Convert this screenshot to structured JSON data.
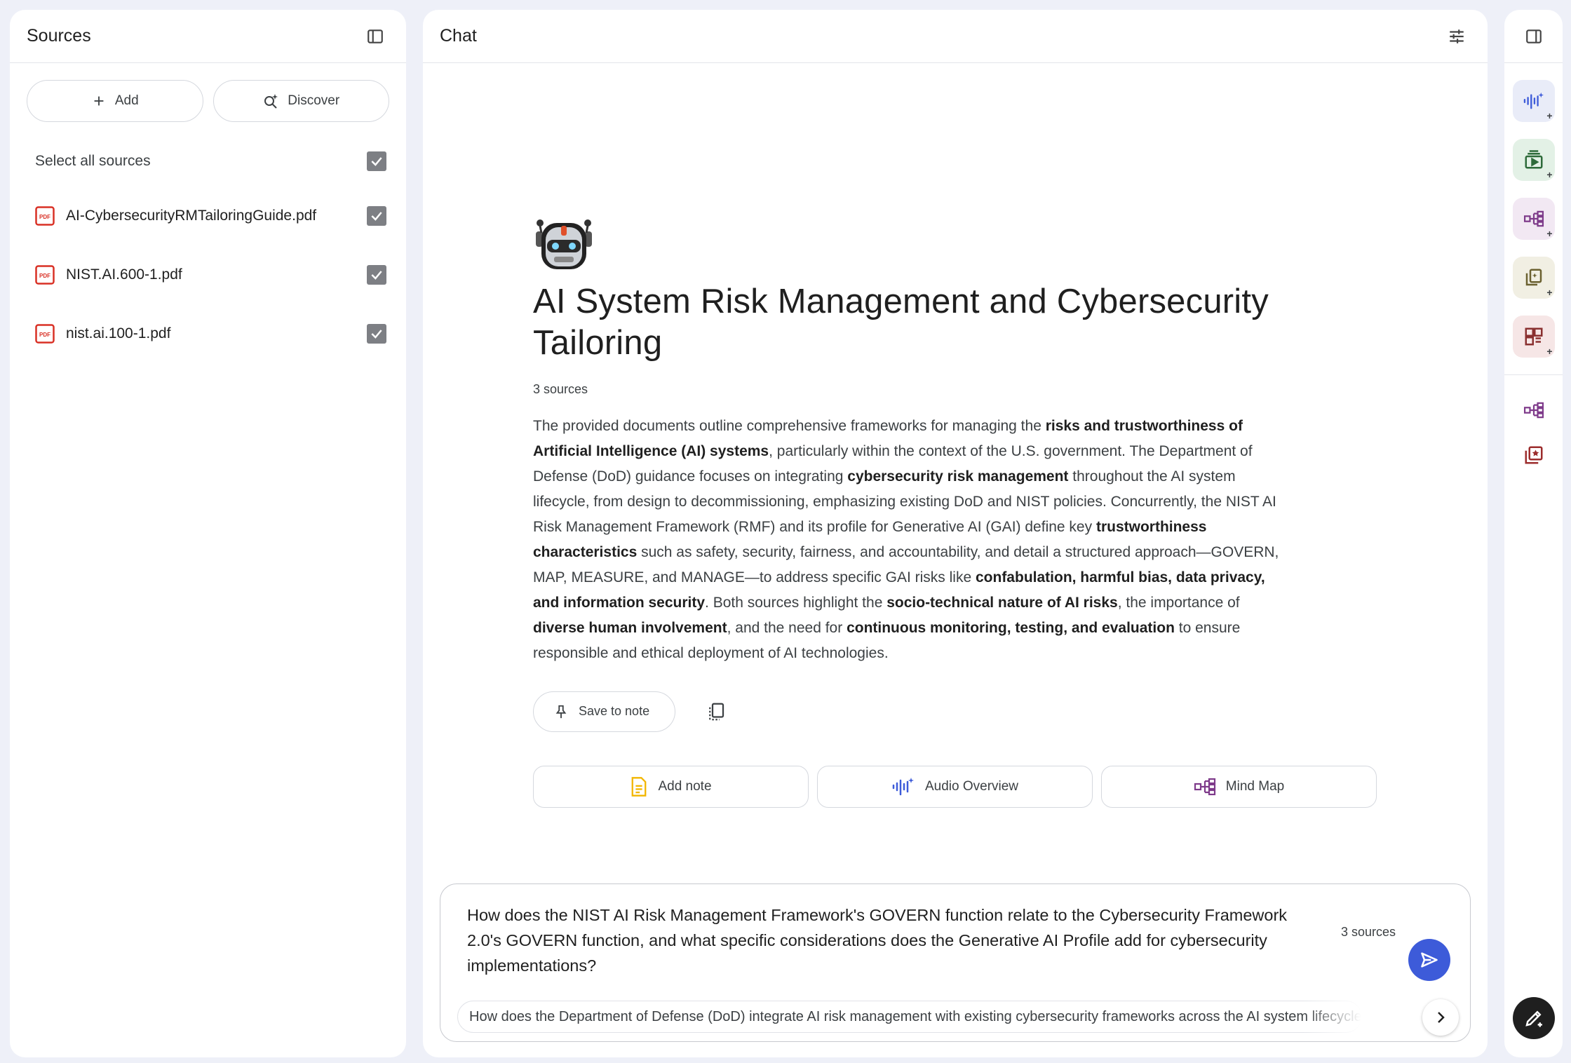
{
  "sources_panel": {
    "title": "Sources",
    "add_label": "Add",
    "discover_label": "Discover",
    "select_all_label": "Select all sources",
    "files": [
      {
        "name": "AI-CybersecurityRMTailoringGuide.pdf",
        "checked": true
      },
      {
        "name": "NIST.AI.600-1.pdf",
        "checked": true
      },
      {
        "name": "nist.ai.100-1.pdf",
        "checked": true
      }
    ]
  },
  "chat_panel": {
    "title": "Chat",
    "notebook_title": "AI System Risk Management and Cybersecurity Tailoring",
    "source_count": "3 sources",
    "summary_segments": [
      {
        "t": "The provided documents outline comprehensive frameworks for managing the ",
        "b": false
      },
      {
        "t": "risks and trustworthiness of Artificial Intelligence (AI) systems",
        "b": true
      },
      {
        "t": ", particularly within the context of the U.S. government. The Department of Defense (DoD) guidance focuses on integrating ",
        "b": false
      },
      {
        "t": "cybersecurity risk management",
        "b": true
      },
      {
        "t": " throughout the AI system lifecycle, from design to decommissioning, emphasizing existing DoD and NIST policies. Concurrently, the NIST AI Risk Management Framework (RMF) and its profile for Generative AI (GAI) define key ",
        "b": false
      },
      {
        "t": "trustworthiness characteristics",
        "b": true
      },
      {
        "t": " such as safety, security, fairness, and accountability, and detail a structured approach—GOVERN, MAP, MEASURE, and MANAGE—to address specific GAI risks like ",
        "b": false
      },
      {
        "t": "confabulation, harmful bias, data privacy, and information security",
        "b": true
      },
      {
        "t": ". Both sources highlight the ",
        "b": false
      },
      {
        "t": "socio-technical nature of AI risks",
        "b": true
      },
      {
        "t": ", the importance of ",
        "b": false
      },
      {
        "t": "diverse human involvement",
        "b": true
      },
      {
        "t": ", and the need for ",
        "b": false
      },
      {
        "t": "continuous monitoring, testing, and evaluation",
        "b": true
      },
      {
        "t": " to ensure responsible and ethical deployment of AI technologies.",
        "b": false
      }
    ],
    "save_to_note_label": "Save to note",
    "quick_actions": {
      "add_note": "Add note",
      "audio_overview": "Audio Overview",
      "mind_map": "Mind Map"
    },
    "composer": {
      "text": "How does the NIST AI Risk Management Framework's GOVERN function relate to the Cybersecurity Framework 2.0's GOVERN function, and what specific considerations does the Generative AI Profile add for cybersecurity implementations?",
      "source_count": "3 sources",
      "suggestion": "How does the Department of Defense (DoD) integrate AI risk management with existing cybersecurity frameworks across the AI system lifecycle?"
    }
  },
  "studio_rail": {
    "buttons": [
      {
        "icon": "audio-overview-icon",
        "bg": "#e9ecf8",
        "color": "#3d5bd9"
      },
      {
        "icon": "video-overview-icon",
        "bg": "#e3f1e6",
        "color": "#2e6b3a"
      },
      {
        "icon": "mind-map-icon",
        "bg": "#f2e8f3",
        "color": "#7e3a8a"
      },
      {
        "icon": "reports-icon",
        "bg": "#f1efe3",
        "color": "#6b6130"
      },
      {
        "icon": "flashcards-icon",
        "bg": "#f6e6e6",
        "color": "#8a3030"
      }
    ],
    "colors": {
      "mind_map": "#7e3a8a",
      "note": "#9c2d2d",
      "add_note": "#f2b600",
      "send": "#3d5bd9"
    }
  }
}
